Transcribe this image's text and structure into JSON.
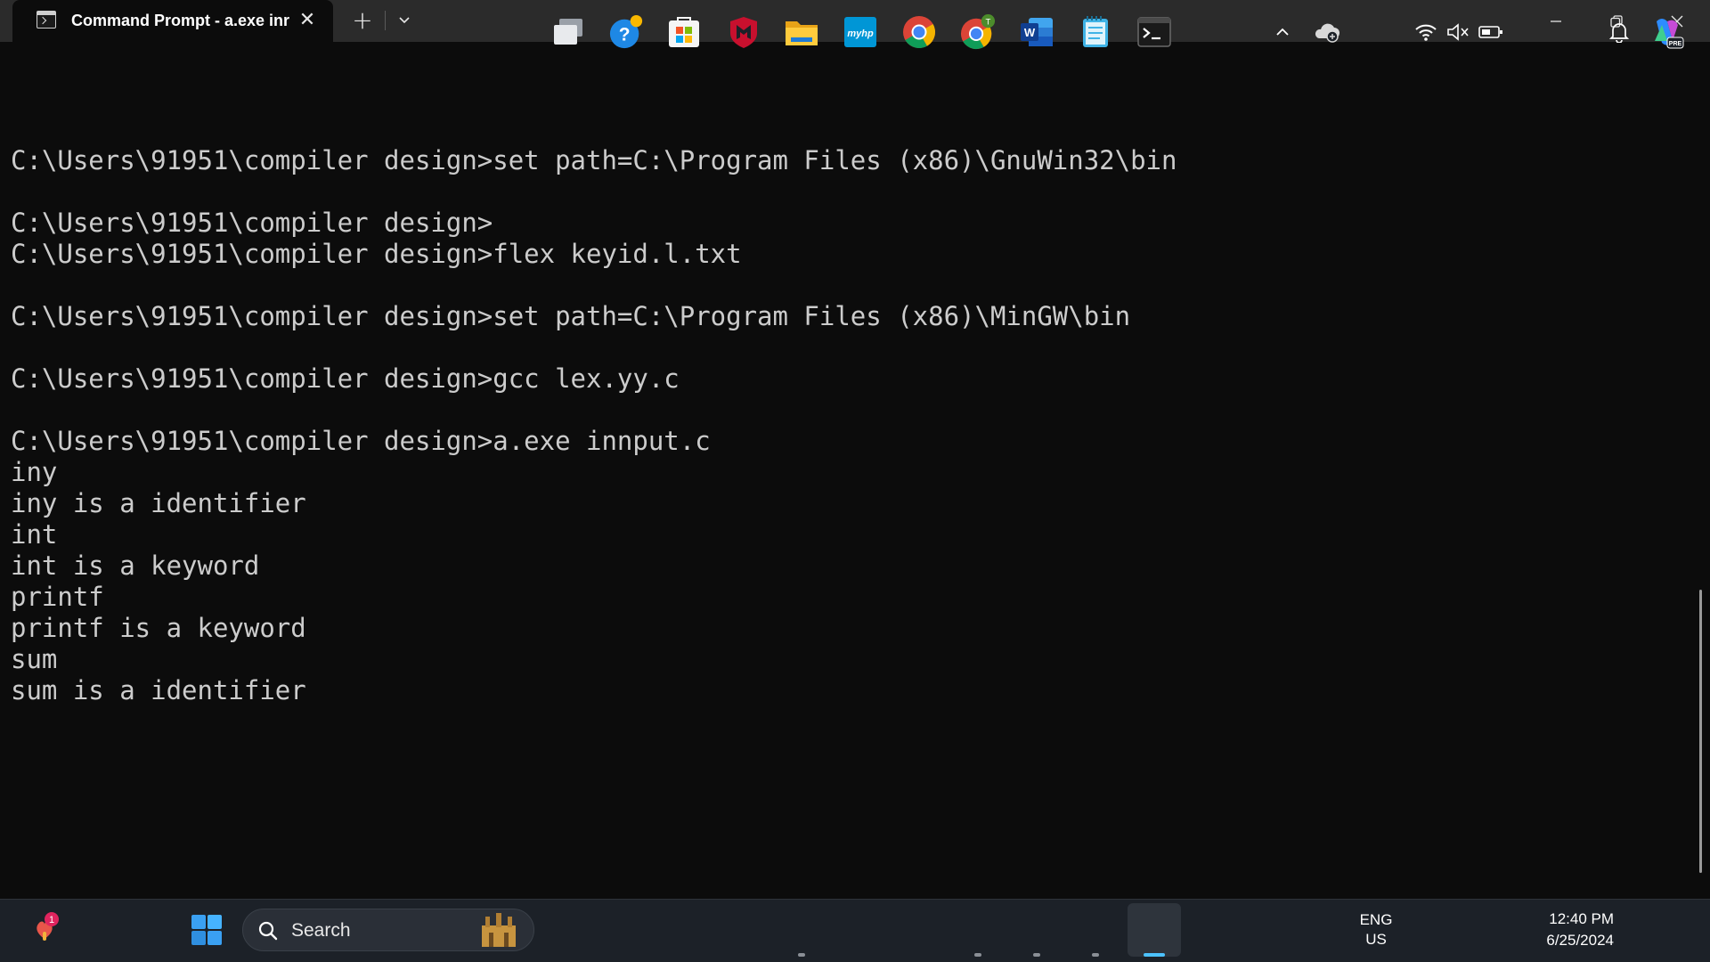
{
  "window": {
    "tab_title": "Command Prompt - a.exe  inr",
    "tab_close_glyph": "✕",
    "new_tab_glyph": "+",
    "icons": {
      "tab_icon": "cmd-icon",
      "dropdown": "chevron-down-icon",
      "minimize": "minimize-icon",
      "maximize": "restore-icon",
      "close": "close-icon"
    }
  },
  "terminal": {
    "lines": [
      "C:\\Users\\91951\\compiler design>set path=C:\\Program Files (x86)\\GnuWin32\\bin",
      "",
      "C:\\Users\\91951\\compiler design>",
      "C:\\Users\\91951\\compiler design>flex keyid.l.txt",
      "",
      "C:\\Users\\91951\\compiler design>set path=C:\\Program Files (x86)\\MinGW\\bin",
      "",
      "C:\\Users\\91951\\compiler design>gcc lex.yy.c",
      "",
      "C:\\Users\\91951\\compiler design>a.exe innput.c",
      "iny",
      "iny is a identifier",
      "int",
      "int is a keyword",
      "printf",
      "printf is a keyword",
      "sum",
      "sum is a identifier"
    ],
    "colors": {
      "background": "#0c0c0c",
      "text": "#cccccc"
    }
  },
  "taskbar": {
    "search_placeholder": "Search",
    "notification_badge": "1",
    "chrome_badge": "T",
    "language_line1": "ENG",
    "language_line2": "US",
    "time": "12:40 PM",
    "date": "6/25/2024",
    "copilot_badge": "PRE",
    "hp_label": "myhp",
    "word_label": "W",
    "apps": [
      "widgets-icon",
      "start-icon",
      "search-icon",
      "task-view-icon",
      "help-icon",
      "store-icon",
      "mcafee-icon",
      "file-explorer-icon",
      "myhp-icon",
      "chrome-icon",
      "chrome-profile-icon",
      "word-icon",
      "notepad-icon",
      "terminal-icon"
    ],
    "tray": [
      "chevron-up-icon",
      "onedrive-icon",
      "wifi-icon",
      "volume-muted-icon",
      "battery-icon",
      "bell-icon",
      "copilot-icon"
    ]
  }
}
